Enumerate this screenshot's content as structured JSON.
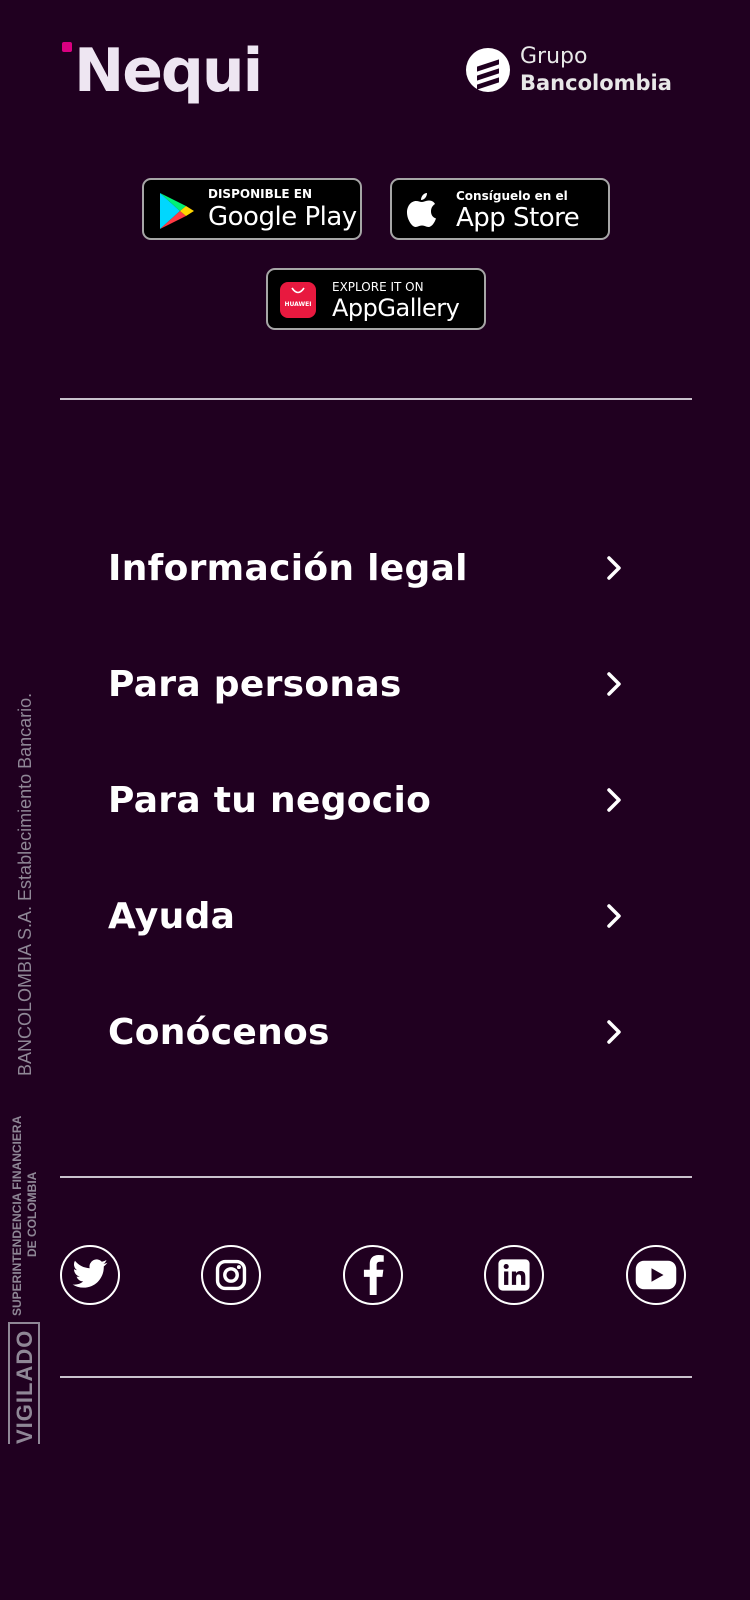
{
  "header": {
    "logo_nequi": "Nequi",
    "logo_grupo_line1": "Grupo",
    "logo_grupo_line2": "Bancolombia",
    "brand_pink": "#da0081"
  },
  "stores": {
    "google_play": {
      "small": "DISPONIBLE EN",
      "big": "Google Play",
      "icon": "google-play-icon"
    },
    "app_store": {
      "small": "Consíguelo en el",
      "big": "App Store",
      "icon": "apple-icon"
    },
    "app_gallery": {
      "small": "EXPLORE IT ON",
      "big": "AppGallery",
      "badge": "HUAWEI",
      "icon": "huawei-appgallery-icon"
    }
  },
  "menu": {
    "items": [
      {
        "label": "Información legal"
      },
      {
        "label": "Para personas"
      },
      {
        "label": "Para tu negocio"
      },
      {
        "label": "Ayuda"
      },
      {
        "label": "Conócenos"
      }
    ]
  },
  "social": {
    "icons": [
      "twitter-icon",
      "instagram-icon",
      "facebook-icon",
      "linkedin-icon",
      "youtube-icon"
    ]
  },
  "side": {
    "legal": "BANCOLOMBIA S.A. Establecimiento Bancario.",
    "sfc_line1": "SUPERINTENDENCIA FINANCIERA",
    "sfc_line2": "DE COLOMBIA",
    "vigilado": "VIGILADO"
  },
  "colors": {
    "background": "#200020",
    "divider": "#c9c1cc",
    "muted_text": "#8f8796"
  }
}
